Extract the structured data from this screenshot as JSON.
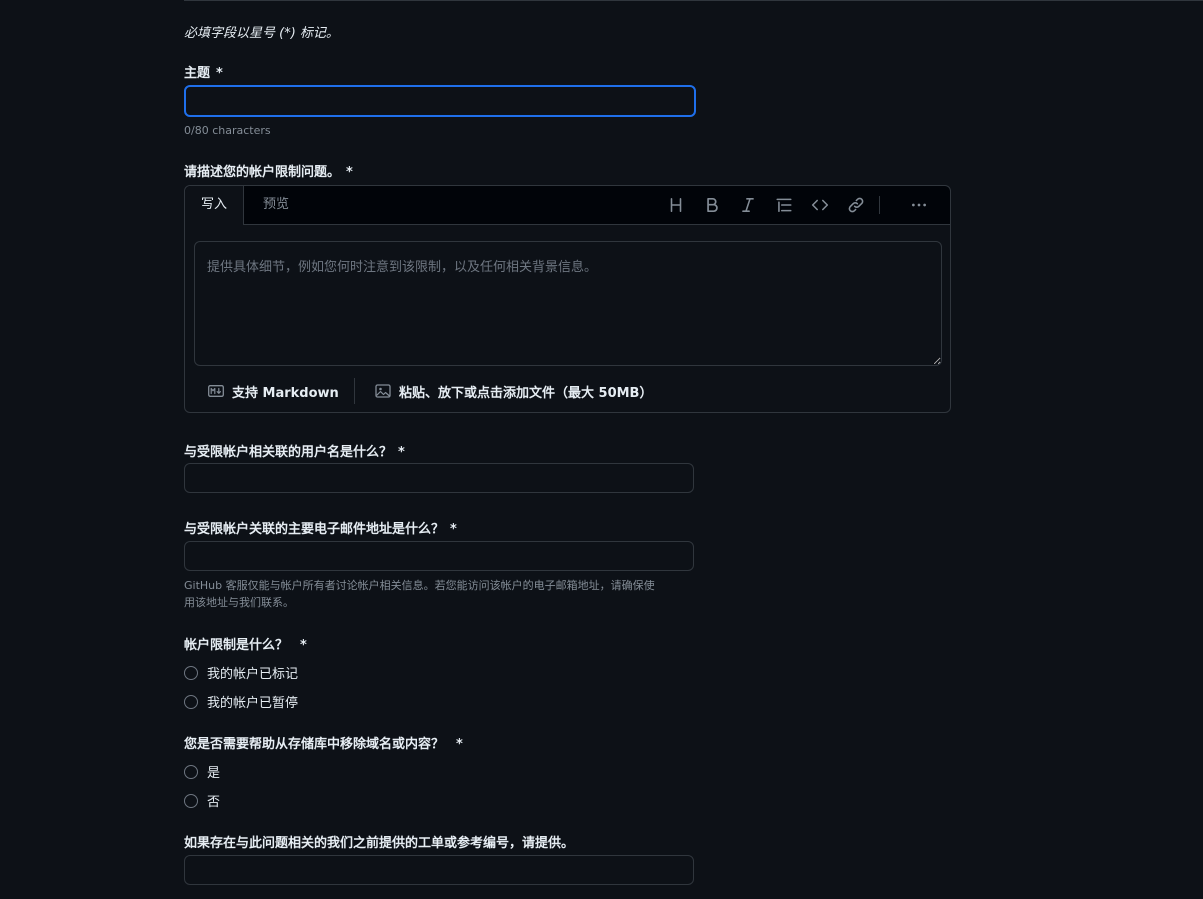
{
  "form": {
    "required_note": "必填字段以星号 (*) 标记。",
    "subject": {
      "label": "主题",
      "required_mark": "*",
      "value": "",
      "counter": "0/80 characters"
    },
    "description": {
      "label": "请描述您的帐户限制问题。",
      "required_mark": "*",
      "tabs": [
        "写入",
        "预览"
      ],
      "toolbar_icons": [
        "heading-icon",
        "bold-icon",
        "italic-icon",
        "list-icon",
        "code-icon",
        "link-icon",
        "more-icon"
      ],
      "placeholder": "提供具体细节，例如您何时注意到该限制，以及任何相关背景信息。",
      "markdown_note": "支持 Markdown",
      "attach_note": "粘贴、放下或点击添加文件（最大 50MB）"
    },
    "username": {
      "label": "与受限帐户相关联的用户名是什么？",
      "required_mark": "*",
      "value": ""
    },
    "email": {
      "label": "与受限帐户关联的主要电子邮件地址是什么？",
      "required_mark": "*",
      "value": "",
      "hint_line1": "GitHub 客服仅能与帐户所有者讨论帐户相关信息。若您能访问该帐户的电子邮箱地址，请确保使",
      "hint_line2": "用该地址与我们联系。"
    },
    "restriction": {
      "label": "帐户限制是什么？",
      "required_mark": "*",
      "options": [
        "我的帐户已标记",
        "我的帐户已暂停"
      ]
    },
    "removal": {
      "label": "您是否需要帮助从存储库中移除域名或内容？",
      "required_mark": "*",
      "options": [
        "是",
        "否"
      ]
    },
    "reference": {
      "label": "如果存在与此问题相关的我们之前提供的工单或参考编号，请提供。",
      "value": ""
    }
  },
  "colors": {
    "background": "#0d1117",
    "border": "#30363d",
    "focus": "#1f6feb",
    "muted": "#848d97"
  }
}
